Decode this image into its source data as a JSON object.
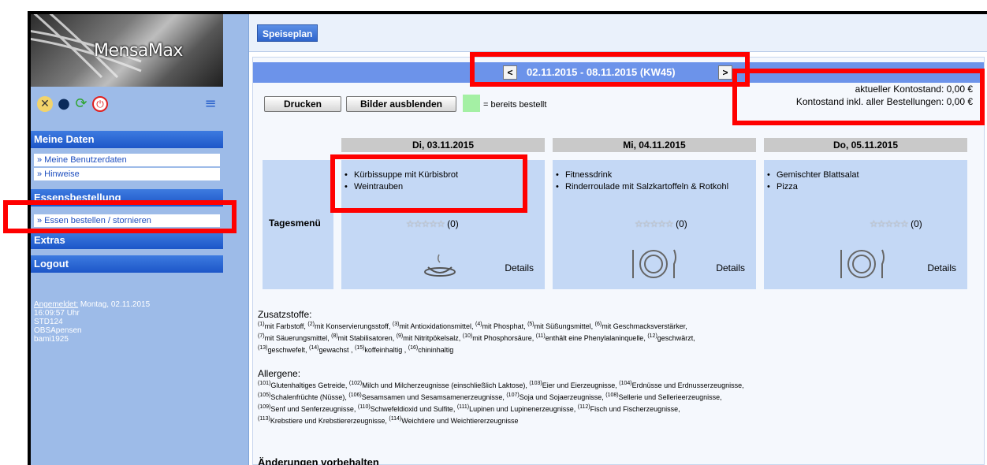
{
  "app": {
    "brand": "MensaMax"
  },
  "sidebar": {
    "sections": {
      "meine_daten": "Meine Daten",
      "essensbestellung": "Essensbestellung",
      "extras": "Extras",
      "logout": "Logout"
    },
    "links": {
      "benutzerdaten": "» Meine Benutzerdaten",
      "hinweise": "» Hinweise",
      "essen": "» Essen bestellen / stornieren"
    },
    "login": {
      "label": "Angemeldet:",
      "date": " Montag, 02.11.2015",
      "time": "16:09:57 Uhr",
      "line3": "STD124",
      "line4": "OBSApensen",
      "line5": "bami1925"
    }
  },
  "tab": {
    "label": "Speiseplan"
  },
  "week": {
    "prev": "<",
    "next": ">",
    "label": "02.11.2015 - 08.11.2015 (KW45)"
  },
  "toolbar": {
    "print": "Drucken",
    "hide_images": "Bilder ausblenden",
    "legend": "= bereits bestellt"
  },
  "account": {
    "balance": "aktueller Kontostand: 0,00 €",
    "balance_incl": "Kontostand inkl. aller Bestellungen: 0,00 €"
  },
  "menu_label": "Tagesmenü",
  "days": [
    {
      "header": "Di, 03.11.2015",
      "items": [
        "Kürbissuppe mit Kürbisbrot",
        "Weintrauben"
      ],
      "rating": "(0)",
      "details": "Details",
      "dish_icon": "soup-bowl-icon"
    },
    {
      "header": "Mi, 04.11.2015",
      "items": [
        "Fitnessdrink",
        "Rinderroulade mit Salzkartoffeln & Rotkohl"
      ],
      "rating": "(0)",
      "details": "Details",
      "dish_icon": "plate-cutlery-icon"
    },
    {
      "header": "Do, 05.11.2015",
      "items": [
        "Gemischter Blattsalat",
        "Pizza"
      ],
      "rating": "(0)",
      "details": "Details",
      "dish_icon": "plate-cutlery-icon"
    }
  ],
  "zusatzstoffe": {
    "title": "Zusatzstoffe:",
    "items": [
      [
        "(1)",
        "mit Farbstoff, "
      ],
      [
        "(2)",
        "mit Konservierungsstoff, "
      ],
      [
        "(3)",
        "mit Antioxidationsmittel, "
      ],
      [
        "(4)",
        "mit Phosphat, "
      ],
      [
        "(5)",
        "mit Süßungsmittel, "
      ],
      [
        "(6)",
        "mit Geschmacksverstärker,"
      ],
      [
        "(7)",
        "mit Säuerungsmittel, "
      ],
      [
        "(8)",
        "mit Stabilisatoren, "
      ],
      [
        "(9)",
        "mit Nitritpökelsalz, "
      ],
      [
        "(10)",
        "mit Phosphorsäure, "
      ],
      [
        "(11)",
        "enthält eine Phenylalaninquelle, "
      ],
      [
        "(12)",
        "geschwärzt,"
      ],
      [
        "(13)",
        "geschwefelt, "
      ],
      [
        "(14)",
        "gewachst , "
      ],
      [
        "(15)",
        "koffeinhaltig , "
      ],
      [
        "(16)",
        "chininhaltig"
      ]
    ]
  },
  "allergene": {
    "title": "Allergene:",
    "items": [
      [
        "(101)",
        "Glutenhaltiges Getreide, "
      ],
      [
        "(102)",
        "Milch und Milcherzeugnisse (einschließlich Laktose), "
      ],
      [
        "(103)",
        "Eier und Eierzeugnisse, "
      ],
      [
        "(104)",
        "Erdnüsse und Erdnusserzeugnisse,"
      ],
      [
        "(105)",
        "Schalenfrüchte (Nüsse), "
      ],
      [
        "(106)",
        "Sesamsamen und Sesamsamenerzeugnisse, "
      ],
      [
        "(107)",
        "Soja und Sojaerzeugnisse, "
      ],
      [
        "(108)",
        "Sellerie und Sellerieerzeugnisse,"
      ],
      [
        "(109)",
        "Senf und Senferzeugnisse, "
      ],
      [
        "(110)",
        "Schwefeldioxid und Sulfite, "
      ],
      [
        "(111)",
        "Lupinen und Lupinenerzeugnisse, "
      ],
      [
        "(112)",
        "Fisch und Fischerzeugnisse,"
      ],
      [
        "(113)",
        "Krebstiere und Krebstiererzeugnisse, "
      ],
      [
        "(114)",
        "Weichtiere und Weichtiererzeugnisse"
      ]
    ]
  },
  "footer_note": "Änderungen vorbehalten",
  "colors": {
    "highlight": "#ff0000",
    "nav_blue": "#1d56c8",
    "week_bar": "#6c93ea",
    "card": "#c4d8f5",
    "ordered_legend": "#a4f0a4"
  }
}
